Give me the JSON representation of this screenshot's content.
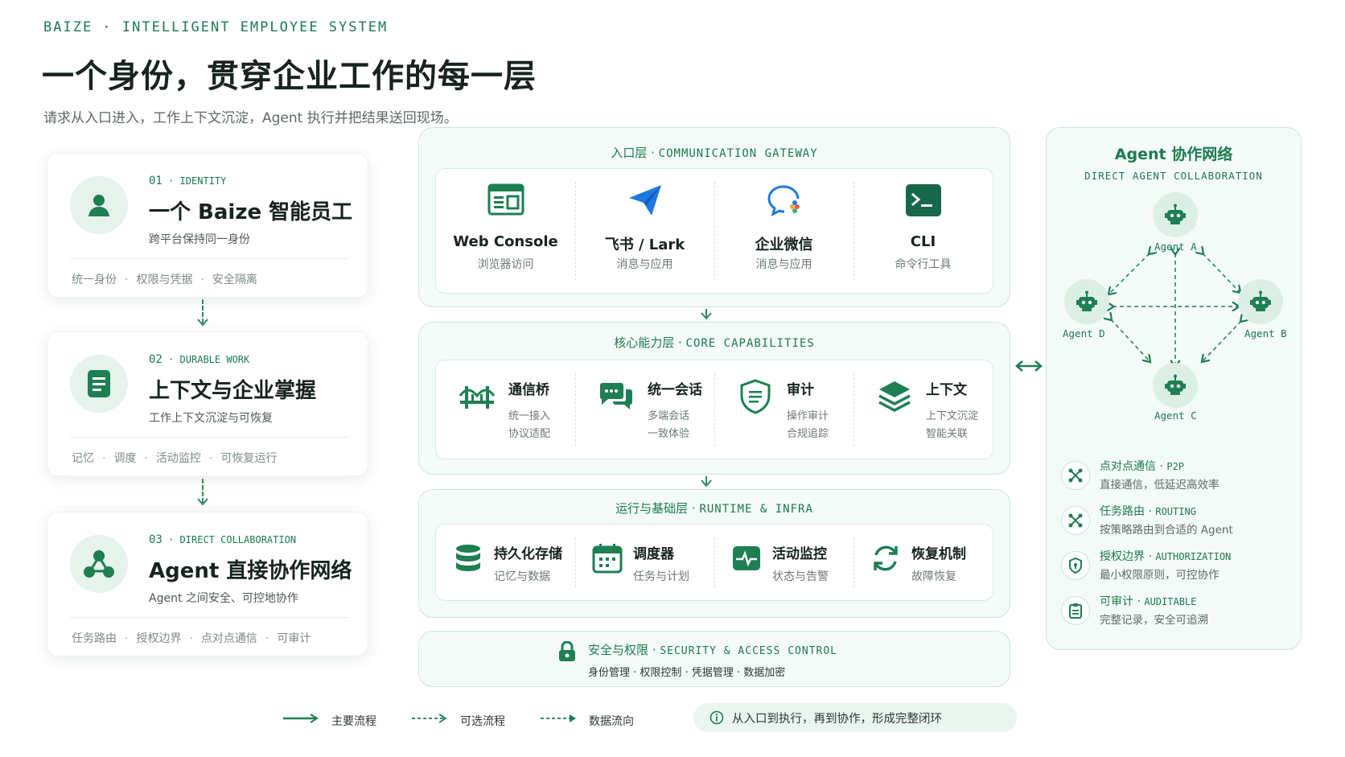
{
  "header": {
    "brand": "BAIZE · INTELLIGENT EMPLOYEE SYSTEM",
    "title": "一个身份，贯穿企业工作的每一层",
    "subtitle": "请求从入口进入，工作上下文沉淀，Agent 执行并把结果送回现场。"
  },
  "pillars": [
    {
      "num": "01",
      "tag": "IDENTITY",
      "icon": "person-icon",
      "title": "一个 Baize 智能员工",
      "desc": "跨平台保持同一身份",
      "tags": [
        "统一身份",
        "权限与凭据",
        "安全隔离"
      ]
    },
    {
      "num": "02",
      "tag": "DURABLE WORK",
      "icon": "document-icon",
      "title": "上下文与企业掌握",
      "desc": "工作上下文沉淀与可恢复",
      "tags": [
        "记忆",
        "调度",
        "活动监控",
        "可恢复运行"
      ]
    },
    {
      "num": "03",
      "tag": "DIRECT COLLABORATION",
      "icon": "network-icon",
      "title": "Agent 直接协作网络",
      "desc": "Agent 之间安全、可控地协作",
      "tags": [
        "任务路由",
        "授权边界",
        "点对点通信",
        "可审计"
      ]
    }
  ],
  "gateway": {
    "title_cn": "入口层",
    "title_en": "COMMUNICATION GATEWAY",
    "items": [
      {
        "icon": "browser-icon",
        "label": "Web Console",
        "sub": "浏览器访问"
      },
      {
        "icon": "paper-plane-icon",
        "label": "飞书 / Lark",
        "sub": "消息与应用"
      },
      {
        "icon": "chat-bubble-icon",
        "label": "企业微信",
        "sub": "消息与应用"
      },
      {
        "icon": "terminal-icon",
        "label": "CLI",
        "sub": "命令行工具"
      }
    ]
  },
  "core": {
    "title_cn": "核心能力层",
    "title_en": "CORE CAPABILITIES",
    "items": [
      {
        "icon": "bridge-icon",
        "label": "通信桥",
        "l1": "统一接入",
        "l2": "协议适配"
      },
      {
        "icon": "chat-icon",
        "label": "统一会话",
        "l1": "多端会话",
        "l2": "一致体验"
      },
      {
        "icon": "shield-icon",
        "label": "审计",
        "l1": "操作审计",
        "l2": "合规追踪"
      },
      {
        "icon": "layers-icon",
        "label": "上下文",
        "l1": "上下文沉淀",
        "l2": "智能关联"
      }
    ]
  },
  "runtime": {
    "title_cn": "运行与基础层",
    "title_en": "RUNTIME & INFRA",
    "items": [
      {
        "icon": "database-icon",
        "label": "持久化存储",
        "sub": "记忆与数据"
      },
      {
        "icon": "calendar-icon",
        "label": "调度器",
        "sub": "任务与计划"
      },
      {
        "icon": "pulse-icon",
        "label": "活动监控",
        "sub": "状态与告警"
      },
      {
        "icon": "refresh-icon",
        "label": "恢复机制",
        "sub": "故障恢复"
      }
    ]
  },
  "security": {
    "icon": "lock-icon",
    "title_cn": "安全与权限",
    "title_en": "SECURITY & ACCESS CONTROL",
    "items": [
      "身份管理",
      "权限控制",
      "凭据管理",
      "数据加密"
    ]
  },
  "network": {
    "title": "Agent 协作网络",
    "subtitle": "DIRECT AGENT COLLABORATION",
    "agents": [
      "Agent A",
      "Agent B",
      "Agent C",
      "Agent D"
    ],
    "features": [
      {
        "icon": "nodes-icon",
        "title_cn": "点对点通信",
        "title_en": "P2P",
        "desc": "直接通信，低延迟高效率"
      },
      {
        "icon": "route-icon",
        "title_cn": "任务路由",
        "title_en": "ROUTING",
        "desc": "按策略路由到合适的 Agent"
      },
      {
        "icon": "shield-icon",
        "title_cn": "授权边界",
        "title_en": "AUTHORIZATION",
        "desc": "最小权限原则，可控协作"
      },
      {
        "icon": "clipboard-icon",
        "title_cn": "可审计",
        "title_en": "AUDITABLE",
        "desc": "完整记录，安全可追溯"
      }
    ]
  },
  "legend": {
    "main": "主要流程",
    "optional": "可选流程",
    "data": "数据流向",
    "note": "从入口到执行，再到协作，形成完整闭环"
  },
  "colors": {
    "accent": "#1a7a4f",
    "accent_dark": "#17684a",
    "panel_bg": "#f4faf7",
    "border": "#cfe6d9"
  }
}
